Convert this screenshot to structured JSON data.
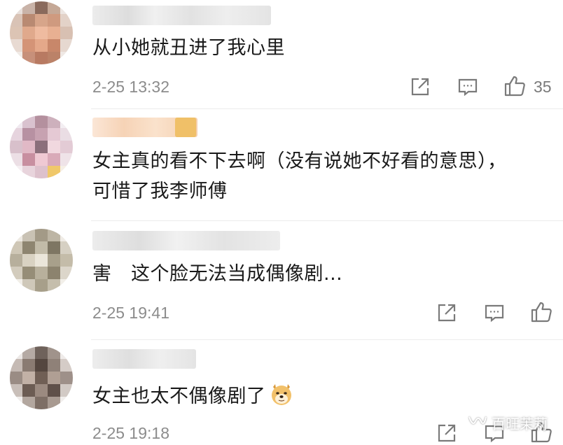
{
  "comments": [
    {
      "text": "从小她就丑进了我心里",
      "time": "2-25 13:32",
      "likes": "35"
    },
    {
      "text_line1": "女主真的看不下去啊（没有说她不好看的意思），",
      "text_line2": "可惜了我李师傅"
    },
    {
      "text": "害　这个脸无法当成偶像剧...",
      "time": "2-25 19:41"
    },
    {
      "text": "女主也太不偶像剧了",
      "emoji": "doge-emoji",
      "time": "2-25 19:18"
    }
  ],
  "icons": [
    "share-icon",
    "comment-icon",
    "like-icon",
    "wechat-channel-icon"
  ],
  "watermark": "百旺茉莉"
}
